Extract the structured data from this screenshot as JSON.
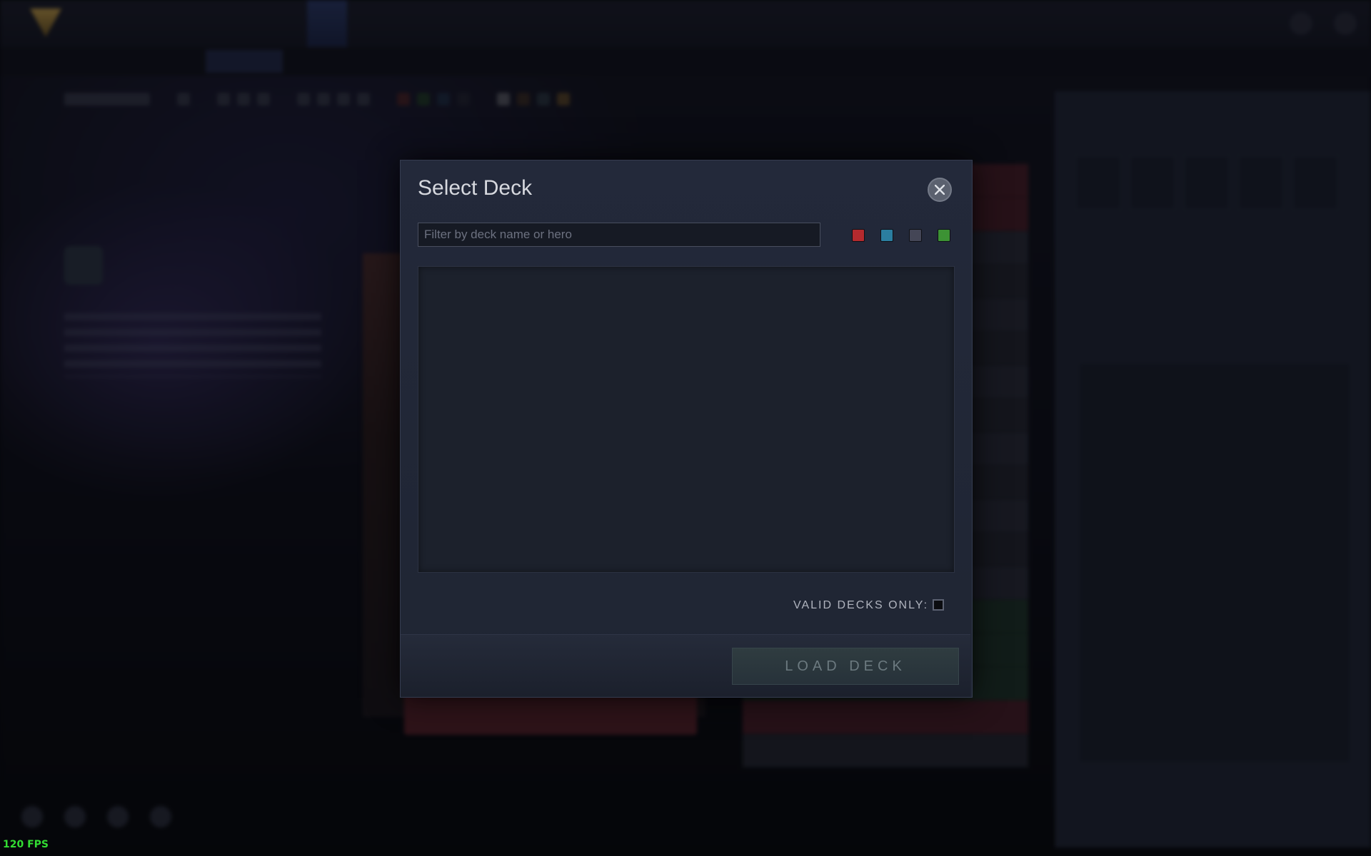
{
  "modal": {
    "title": "Select Deck",
    "filter_placeholder": "Filter by deck name or hero",
    "filter_value": "",
    "color_filters": [
      {
        "name": "red",
        "color": "#b42a2e"
      },
      {
        "name": "blue",
        "color": "#2b7ea0"
      },
      {
        "name": "black",
        "color": "#444656"
      },
      {
        "name": "green",
        "color": "#3c9234"
      }
    ],
    "valid_decks_only_label": "VALID DECKS ONLY:",
    "valid_decks_only_checked": false,
    "load_button_label": "LOAD DECK",
    "close_icon": "close-icon"
  },
  "overlay": {
    "fps_text": "120 FPS"
  }
}
